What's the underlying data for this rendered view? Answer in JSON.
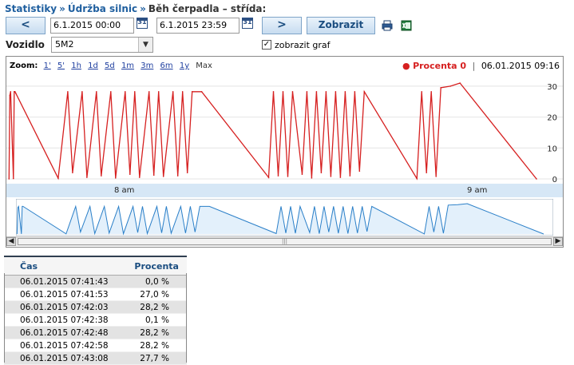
{
  "breadcrumb": {
    "items": [
      "Statistiky",
      "Údržba silnic",
      "Běh čerpadla – střída:"
    ],
    "separator": "»"
  },
  "toolbar": {
    "prev_label": "<",
    "next_label": ">",
    "from_value": "6.1.2015 00:00",
    "to_value": "6.1.2015 23:59",
    "calendar_day": "31",
    "show_label": "Zobrazit",
    "print_icon": "printer-icon",
    "excel_icon": "excel-icon"
  },
  "vehicle": {
    "label": "Vozidlo",
    "selected": "5M2",
    "show_graph_label": "zobrazit graf",
    "show_graph_checked": "✓"
  },
  "chart": {
    "zoom_label": "Zoom:",
    "zoom_options": [
      "1'",
      "5'",
      "1h",
      "1d",
      "5d",
      "1m",
      "3m",
      "6m",
      "1y"
    ],
    "zoom_max": "Max",
    "legend_series": "Procenta 0",
    "legend_time": "06.01.2015 09:16",
    "series_color": "#d62020",
    "navigator_color": "#2a7fc8"
  },
  "chart_data": {
    "type": "line",
    "yticks": [
      0,
      10,
      20,
      30
    ],
    "ylim": [
      0,
      31
    ],
    "xticks": [
      "8 am",
      "9 am"
    ],
    "series": [
      {
        "name": "Procenta 0",
        "x": [
          "07:41:43",
          "07:41:53",
          "07:42:03",
          "07:42:38",
          "07:42:48",
          "07:42:58",
          "07:43:08",
          "07:52",
          "07:54",
          "07:55",
          "07:57",
          "07:58",
          "08:00",
          "08:01",
          "08:03",
          "08:04",
          "08:06",
          "08:07",
          "08:08",
          "08:09",
          "08:11",
          "08:12",
          "08:13",
          "08:14",
          "08:16",
          "08:17",
          "08:18",
          "08:19",
          "08:20",
          "08:22",
          "08:36",
          "08:37",
          "08:38",
          "08:39",
          "08:40",
          "08:41",
          "08:43",
          "08:44",
          "08:45",
          "08:46",
          "08:47",
          "08:48",
          "08:49",
          "08:50",
          "08:51",
          "08:52",
          "08:53",
          "08:54",
          "08:55",
          "08:56",
          "09:07",
          "09:08",
          "09:09",
          "09:10",
          "09:11",
          "09:12",
          "09:14",
          "09:16",
          "09:32"
        ],
        "y": [
          0.0,
          27.0,
          28.2,
          0.1,
          28.2,
          28.2,
          27.7,
          0.2,
          28.2,
          2.0,
          28.2,
          0.5,
          28.2,
          1.0,
          28.2,
          0.3,
          28.2,
          1.5,
          28.2,
          0.5,
          28.2,
          1.2,
          28.2,
          0.8,
          28.2,
          1.0,
          28.2,
          2.0,
          28.2,
          28.2,
          0.5,
          28.2,
          1.0,
          28.2,
          0.8,
          28.2,
          1.5,
          28.2,
          0.3,
          28.2,
          2.0,
          28.2,
          0.8,
          28.2,
          0.5,
          28.2,
          1.0,
          28.2,
          2.5,
          28.2,
          0.1,
          28.2,
          2.0,
          28.2,
          0.8,
          29.5,
          30.0,
          31.0,
          0.0
        ]
      }
    ]
  },
  "table": {
    "headers": [
      "Čas",
      "Procenta"
    ],
    "rows": [
      [
        "06.01.2015 07:41:43",
        "0,0 %"
      ],
      [
        "06.01.2015 07:41:53",
        "27,0 %"
      ],
      [
        "06.01.2015 07:42:03",
        "28,2 %"
      ],
      [
        "06.01.2015 07:42:38",
        "0,1 %"
      ],
      [
        "06.01.2015 07:42:48",
        "28,2 %"
      ],
      [
        "06.01.2015 07:42:58",
        "28,2 %"
      ],
      [
        "06.01.2015 07:43:08",
        "27,7 %"
      ]
    ]
  }
}
